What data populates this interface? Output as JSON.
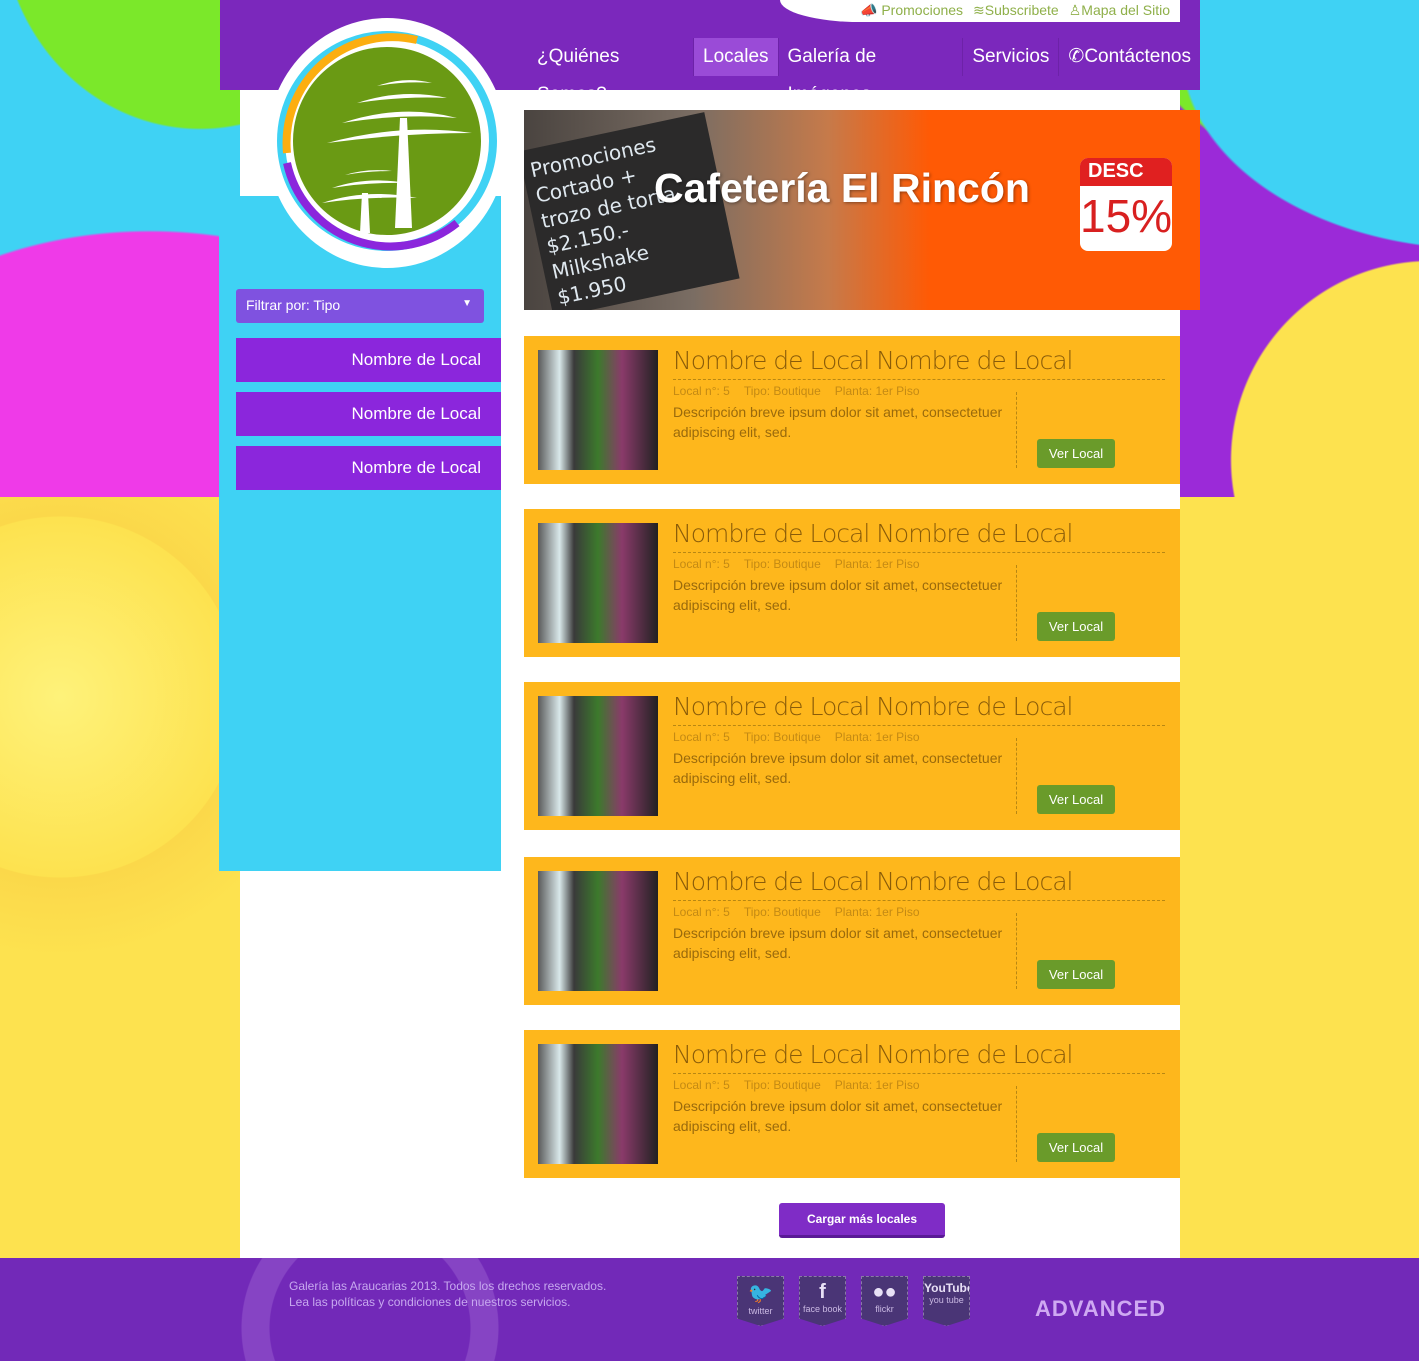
{
  "top_links": [
    {
      "icon": "megaphone-icon",
      "label": "Promociones"
    },
    {
      "icon": "rss-icon",
      "label": "Subscribete"
    },
    {
      "icon": "sitemap-icon",
      "label": "Mapa del Sitio"
    }
  ],
  "nav": [
    {
      "label": "¿Quiénes Somos?"
    },
    {
      "label": "Locales",
      "active": true
    },
    {
      "label": "Galería de Imágenes"
    },
    {
      "label": "Servicios"
    },
    {
      "label": "Contáctenos",
      "icon": "phone-icon"
    }
  ],
  "sidebar": {
    "filter": "Filtrar por: Tipo",
    "items": [
      "Nombre de Local",
      "Nombre de Local",
      "Nombre de Local"
    ]
  },
  "banner": {
    "title": "Cafetería El Rincón",
    "board_lines": [
      "Promociones",
      "Cortado +",
      "trozo de torta",
      "$2.150.-",
      "Milkshake",
      "$1.950"
    ],
    "badge_top": "DESC",
    "badge_value": "15%"
  },
  "cards": [
    {
      "name": "Nombre de Local Nombre de Local",
      "local": "Local n°: 5",
      "tipo": "Tipo: Boutique",
      "planta": "Planta: 1er Piso",
      "desc": "Descripción breve ipsum dolor sit amet, consectetuer adipiscing elit, sed.",
      "button": "Ver Local"
    },
    {
      "name": "Nombre de Local Nombre de Local",
      "local": "Local n°: 5",
      "tipo": "Tipo: Boutique",
      "planta": "Planta: 1er Piso",
      "desc": "Descripción breve ipsum dolor sit amet, consectetuer adipiscing elit, sed.",
      "button": "Ver Local"
    },
    {
      "name": "Nombre de Local Nombre de Local",
      "local": "Local n°: 5",
      "tipo": "Tipo: Boutique",
      "planta": "Planta: 1er Piso",
      "desc": "Descripción breve ipsum dolor sit amet, consectetuer adipiscing elit, sed.",
      "button": "Ver Local"
    },
    {
      "name": "Nombre de Local Nombre de Local",
      "local": "Local n°: 5",
      "tipo": "Tipo: Boutique",
      "planta": "Planta: 1er Piso",
      "desc": "Descripción breve ipsum dolor sit amet, consectetuer adipiscing elit, sed.",
      "button": "Ver Local"
    },
    {
      "name": "Nombre de Local Nombre de Local",
      "local": "Local n°: 5",
      "tipo": "Tipo: Boutique",
      "planta": "Planta: 1er Piso",
      "desc": "Descripción breve ipsum dolor sit amet, consectetuer adipiscing elit, sed.",
      "button": "Ver Local"
    }
  ],
  "load_more": "Cargar más locales",
  "footer": {
    "line1": "Galería las Araucarias 2013. Todos los drechos reservados.",
    "line2": "Lea las políticas y condiciones de nuestros servicios.",
    "social": [
      {
        "icon": "twitter-icon",
        "label": "twitter"
      },
      {
        "icon": "facebook-icon",
        "label": "face book"
      },
      {
        "icon": "flickr-icon",
        "label": "flickr"
      },
      {
        "icon": "youtube-icon",
        "label": "you tube"
      }
    ],
    "brand": "ADVANCED"
  },
  "colors": {
    "purple": "#7b28bc",
    "cyan": "#3fd2f4",
    "card": "#feb71c",
    "button_green": "#6a9b2a",
    "banner_orange": "#ff5a05"
  }
}
